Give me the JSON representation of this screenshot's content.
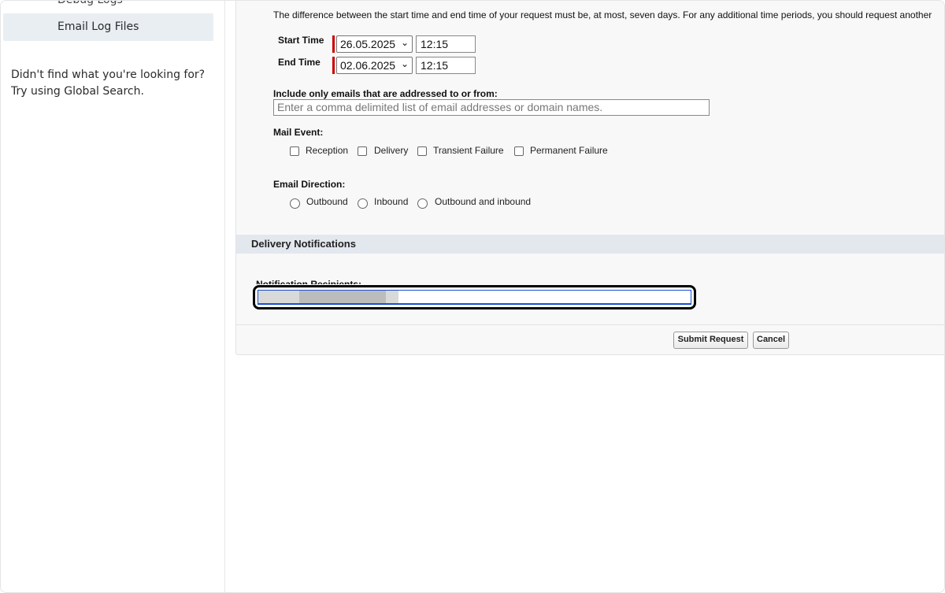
{
  "sidebar": {
    "partial_item": "Debug Logs",
    "active_item": "Email Log Files",
    "help_line1": "Didn't find what you're looking for?",
    "help_line2": "Try using Global Search."
  },
  "form": {
    "note": "The difference between the start time and end time of your request must be, at most, seven days. For any additional time periods, you should request another",
    "start_label": "Start Time",
    "start_date": "26.05.2025",
    "start_time": "12:15",
    "end_label": "End Time",
    "end_date": "02.06.2025",
    "end_time": "12:15",
    "include_label": "Include only emails that are addressed to or from:",
    "include_placeholder": "Enter a comma delimited list of email addresses or domain names.",
    "mail_event_label": "Mail Event:",
    "mail_events": [
      "Reception",
      "Delivery",
      "Transient Failure",
      "Permanent Failure"
    ],
    "direction_label": "Email Direction:",
    "directions": [
      "Outbound",
      "Inbound",
      "Outbound and inbound"
    ]
  },
  "delivery": {
    "section_title": "Delivery Notifications",
    "recipients_label": "Notification Recipients:"
  },
  "buttons": {
    "submit": "Submit Request",
    "cancel": "Cancel"
  },
  "colors": {
    "required_bar": "#cc0000",
    "section_bar": "#e3e7ee",
    "focus_border": "#1a4fd1"
  }
}
